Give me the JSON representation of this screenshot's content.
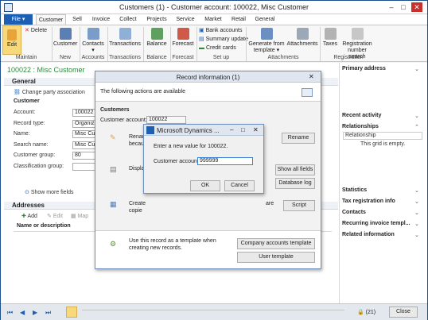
{
  "window": {
    "title": "Customers (1) - Customer account: 100022, Misc Customer",
    "min": "–",
    "max": "□",
    "close": "✕"
  },
  "ribbon_tabs": [
    "File",
    "Customer",
    "Sell",
    "Invoice",
    "Collect",
    "Projects",
    "Service",
    "Market",
    "Retail",
    "General"
  ],
  "ribbon": {
    "edit": "Edit",
    "delete": "Delete",
    "customer": "Customer",
    "contacts": "Contacts",
    "transactions": "Transactions",
    "balance": "Balance",
    "forecast": "Forecast",
    "bank_accounts": "Bank accounts",
    "summary_update": "Summary update",
    "credit_cards": "Credit cards",
    "generate_template": "Generate from",
    "generate_template2": "template",
    "attachments": "Attachments",
    "taxes": "Taxes",
    "registration_search": "Registration",
    "registration_search2": "number search",
    "groups": {
      "maintain": "Maintain",
      "new": "New",
      "accounts": "Accounts",
      "transactions": "Transactions",
      "balance": "Balance",
      "forecast": "Forecast",
      "setup": "Set up",
      "attachments": "Attachments",
      "registration": "Registration"
    }
  },
  "record": {
    "title": "100022 : Misc Customer"
  },
  "general": {
    "header": "General",
    "change_party": "Change party association",
    "customer_section": "Customer",
    "fields": [
      {
        "label": "Account:",
        "value": "100022"
      },
      {
        "label": "Record type:",
        "value": "Organiza"
      },
      {
        "label": "Name:",
        "value": "Misc Cus"
      },
      {
        "label": "Search name:",
        "value": "Misc Cus"
      },
      {
        "label": "Customer group:",
        "value": "80"
      },
      {
        "label": "Classification group:",
        "value": ""
      }
    ],
    "show_more": "Show more fields"
  },
  "addresses": {
    "header": "Addresses",
    "add": "Add",
    "edit": "Edit",
    "map": "Map",
    "column": "Name or description"
  },
  "sidebar": {
    "primary_address": "Primary address",
    "recent_activity": "Recent activity",
    "relationships": "Relationships",
    "relationship_col": "Relationship",
    "grid_empty": "This grid is empty.",
    "statistics": "Statistics",
    "tax_registration": "Tax registration info",
    "contacts": "Contacts",
    "recurring_invoice": "Recurring invoice templ...",
    "related_information": "Related information"
  },
  "record_info": {
    "title": "Record information (1)",
    "intro": "The following actions are available",
    "customers_header": "Customers",
    "account_label": "Customer account:",
    "account_value": "100022",
    "rename_text1": "Renam",
    "rename_text2": "becau",
    "rename": "Rename",
    "display_text": "Displa",
    "show_all_fields": "Show all fields",
    "database_log": "Database log",
    "create_text1": "Create",
    "create_text2": "copie",
    "create_text3": "are",
    "script": "Script",
    "template_text1": "Use this record as a template when",
    "template_text2": "creating new records.",
    "company_template": "Company accounts template",
    "user_template": "User template"
  },
  "rename_dialog": {
    "title": "Microsoft Dynamics ...",
    "prompt": "Enter a new value for 100022.",
    "label": "Customer account:",
    "value": "999999",
    "ok": "OK",
    "cancel": "Cancel"
  },
  "statusbar": {
    "count": "(21)",
    "close": "Close"
  }
}
